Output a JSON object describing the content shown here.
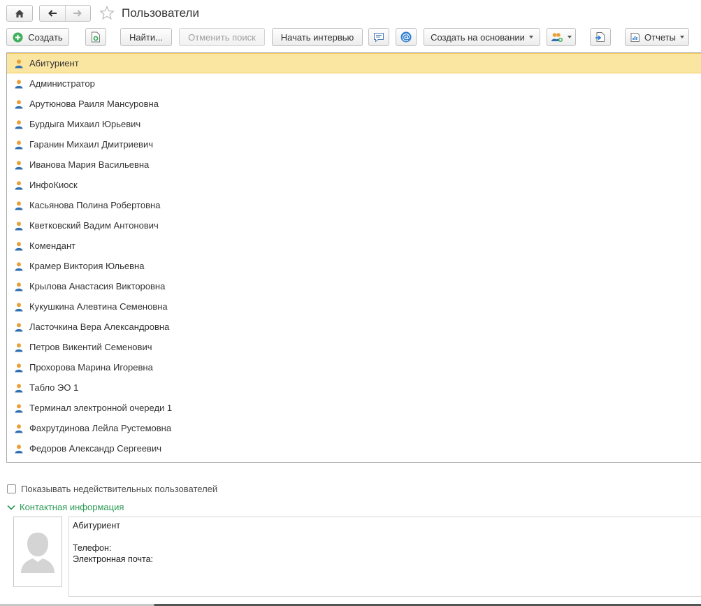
{
  "header": {
    "title": "Пользователи"
  },
  "toolbar": {
    "create_label": "Создать",
    "find_label": "Найти...",
    "cancel_search_label": "Отменить поиск",
    "start_interview_label": "Начать интервью",
    "create_based_label": "Создать на основании",
    "reports_label": "Отчеты"
  },
  "users": [
    {
      "label": "Абитуриент"
    },
    {
      "label": "Администратор"
    },
    {
      "label": "Арутюнова Раиля Мансуровна"
    },
    {
      "label": "Бурдыга Михаил Юрьевич"
    },
    {
      "label": "Гаранин Михаил Дмитриевич"
    },
    {
      "label": "Иванова Мария Васильевна"
    },
    {
      "label": "ИнфоКиоск"
    },
    {
      "label": "Касьянова Полина Робертовна"
    },
    {
      "label": "Кветковский Вадим Антонович"
    },
    {
      "label": "Комендант"
    },
    {
      "label": "Крамер Виктория Юльевна"
    },
    {
      "label": "Крылова Анастасия Викторовна"
    },
    {
      "label": "Кукушкина Алевтина Семеновна"
    },
    {
      "label": "Ласточкина Вера Александровна"
    },
    {
      "label": "Петров Викентий Семенович"
    },
    {
      "label": "Прохорова Марина Игоревна"
    },
    {
      "label": "Табло ЭО 1"
    },
    {
      "label": "Терминал электронной очереди 1"
    },
    {
      "label": "Фахрутдинова Лейла Рустемовна"
    },
    {
      "label": "Федоров Александр Сергеевич"
    }
  ],
  "selected_index": 0,
  "show_invalid": {
    "label": "Показывать недействительных пользователей",
    "checked": false
  },
  "contact": {
    "section_label": "Контактная информация",
    "name": "Абитуриент",
    "phone_label": "Телефон:",
    "email_label": "Электронная почта:"
  },
  "colors": {
    "accent_green": "#2a9a53",
    "selected_row": "#fbe6a1",
    "selected_border": "#f0c759",
    "icon_blue": "#2f6fb0",
    "icon_orange": "#e8a13a"
  }
}
